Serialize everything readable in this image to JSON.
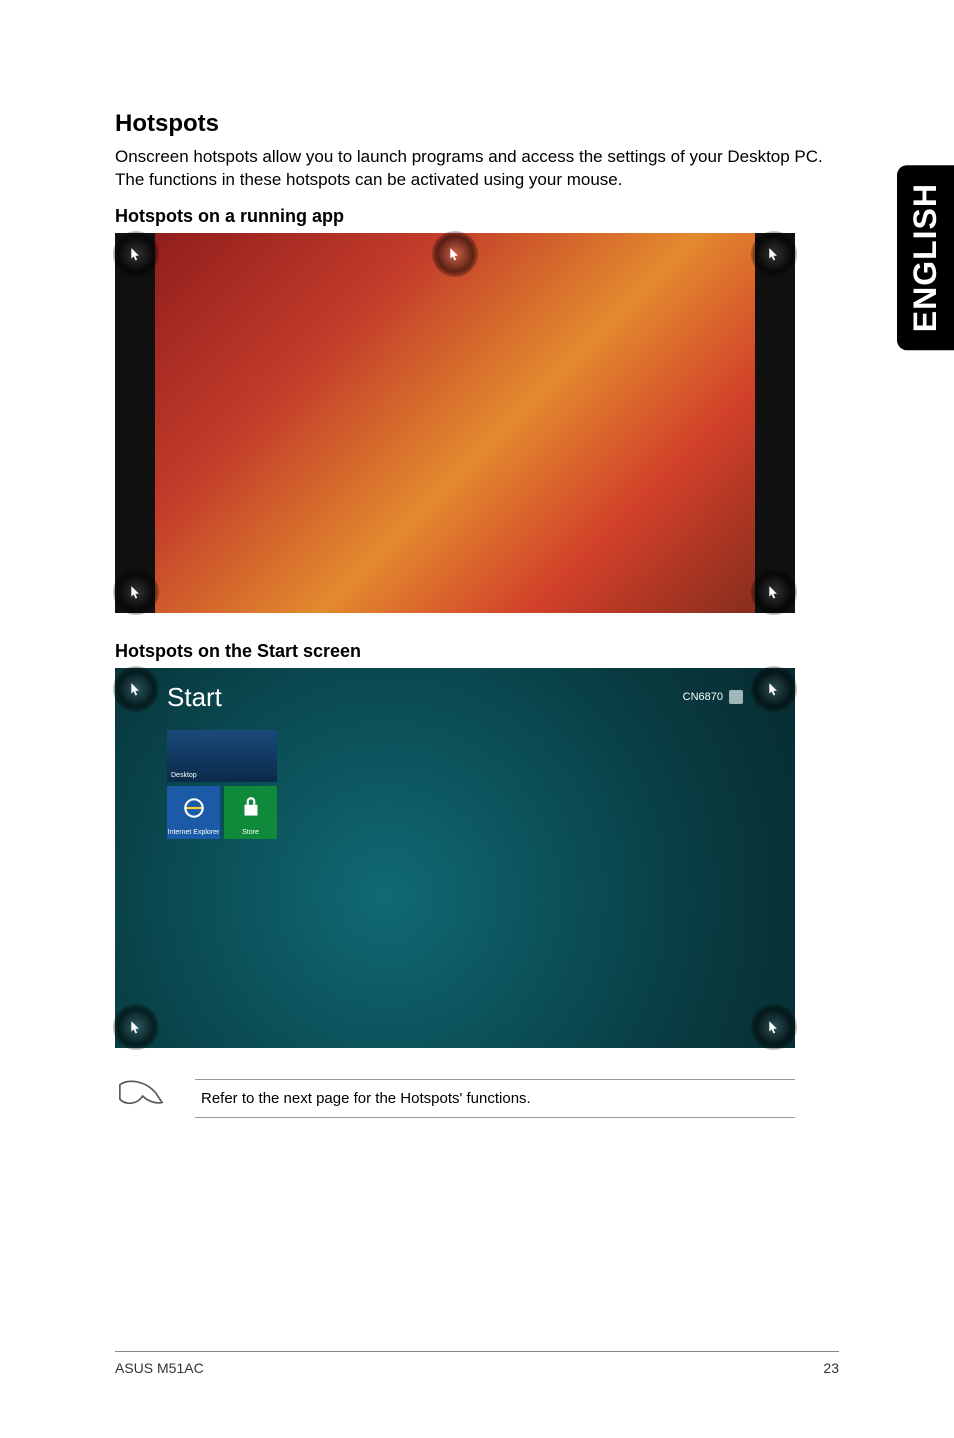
{
  "language_tab": "ENGLISH",
  "title": "Hotspots",
  "intro": "Onscreen hotspots allow you to launch programs and access the settings of your Desktop PC. The functions in these hotspots can be activated using your mouse.",
  "subhead_running": "Hotspots on a running app",
  "subhead_start": "Hotspots on the Start screen",
  "start_screen": {
    "title": "Start",
    "user": "CN6870",
    "tile_desktop": "Desktop",
    "tile_ie": "Internet Explorer",
    "tile_store": "Store"
  },
  "note": "Refer to the next page for the Hotspots' functions.",
  "footer_model": "ASUS M51AC",
  "footer_page": "23"
}
